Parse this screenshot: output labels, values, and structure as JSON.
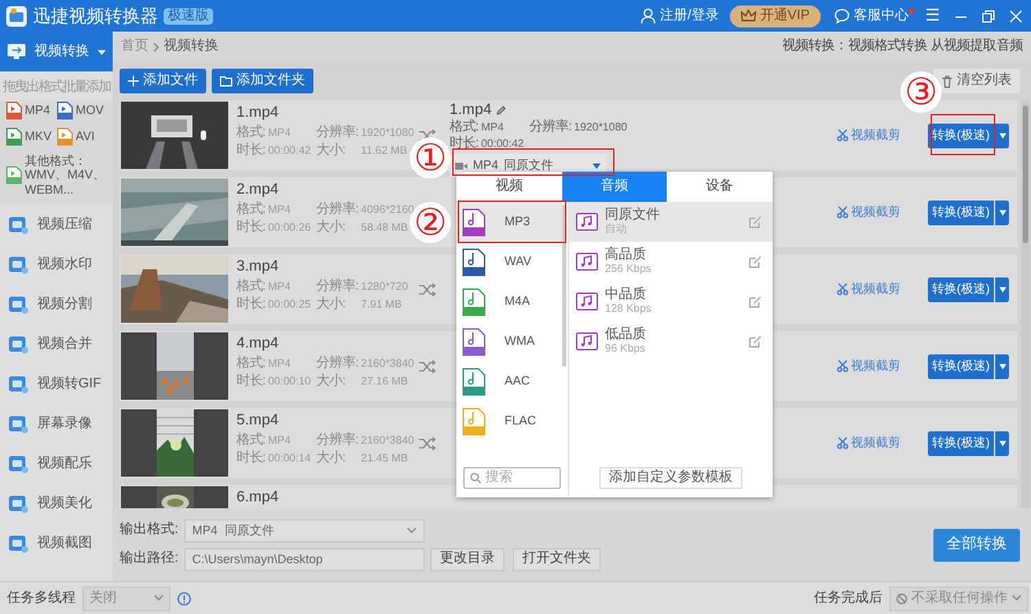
{
  "app": {
    "title": "迅捷视频转换器",
    "edition": "极速版"
  },
  "header": {
    "login": "注册/登录",
    "vip": "开通VIP",
    "support": "客服中心",
    "support_unread": true,
    "menu": "☰"
  },
  "sidebar": {
    "current": {
      "label": "视频转换",
      "expanded": true
    },
    "hint": "拖曳出格式批量添加",
    "formats": [
      {
        "label": "MP4",
        "color": "#e0583a"
      },
      {
        "label": "MOV",
        "color": "#3a6ec0"
      },
      {
        "label": "MKV",
        "color": "#3aa050"
      },
      {
        "label": "AVI",
        "color": "#e8902a"
      },
      {
        "label": "其他格式：WMV、M4V、WEBM...",
        "color": "#5ab86a"
      }
    ],
    "items": [
      {
        "label": "视频压缩"
      },
      {
        "label": "视频水印"
      },
      {
        "label": "视频分割"
      },
      {
        "label": "视频合并"
      },
      {
        "label": "视频转GIF"
      },
      {
        "label": "屏幕录像"
      },
      {
        "label": "视频配乐"
      },
      {
        "label": "视频美化"
      },
      {
        "label": "视频截图"
      }
    ]
  },
  "breadcrumb": {
    "home": "首页",
    "current": "视频转换"
  },
  "description": "视频转换：视频格式转换 从视频提取音频",
  "toolbar": {
    "add_file": "添加文件",
    "add_folder": "添加文件夹",
    "clear": "清空列表"
  },
  "files": [
    {
      "name": "1.mp4",
      "info": [
        {
          "label": "格式:",
          "value": "MP4"
        },
        {
          "label": "分辨率:",
          "value": "1920*1080"
        },
        {
          "label": "时长:",
          "value": "00:00:42"
        },
        {
          "label": "大小:",
          "value": "11.62 MB"
        }
      ],
      "swap_icon": true,
      "output": {
        "name": "1.mp4",
        "info": [
          {
            "label": "格式:",
            "value": "MP4"
          },
          {
            "label": "分辨率:",
            "value": "1920*1080"
          },
          {
            "label": "时长:",
            "value": "00:00:42"
          }
        ],
        "format": "MP4",
        "preset": "同原文件"
      },
      "trim": "视频截剪",
      "convert": "转换(极速)"
    },
    {
      "name": "2.mp4",
      "info": [
        {
          "label": "格式:",
          "value": "MP4"
        },
        {
          "label": "分辨率:",
          "value": "4096*2160"
        },
        {
          "label": "时长:",
          "value": "00:00:26"
        },
        {
          "label": "大小:",
          "value": "58.48 MB"
        }
      ],
      "swap_icon": false,
      "trim": "视频截剪",
      "convert": "转换(极速)"
    },
    {
      "name": "3.mp4",
      "info": [
        {
          "label": "格式:",
          "value": "MP4"
        },
        {
          "label": "分辨率:",
          "value": "1280*720"
        },
        {
          "label": "时长:",
          "value": "00:00:25"
        },
        {
          "label": "大小:",
          "value": "7.91 MB"
        }
      ],
      "swap_icon": true,
      "trim": "视频截剪",
      "convert": "转换(极速)"
    },
    {
      "name": "4.mp4",
      "info": [
        {
          "label": "格式:",
          "value": "MP4"
        },
        {
          "label": "分辨率:",
          "value": "2160*3840"
        },
        {
          "label": "时长:",
          "value": "00:00:10"
        },
        {
          "label": "大小:",
          "value": "27.16 MB"
        }
      ],
      "swap_icon": true,
      "trim": "视频截剪",
      "convert": "转换(极速)"
    },
    {
      "name": "5.mp4",
      "info": [
        {
          "label": "格式:",
          "value": "MP4"
        },
        {
          "label": "分辨率:",
          "value": "2160*3840"
        },
        {
          "label": "时长:",
          "value": "00:00:14"
        },
        {
          "label": "大小:",
          "value": "21.45 MB"
        }
      ],
      "swap_icon": true,
      "trim": "视频截剪",
      "convert": "转换(极速)"
    },
    {
      "name": "6.mp4",
      "swap_icon": false
    }
  ],
  "popup": {
    "tabs": [
      {
        "label": "视频",
        "selected": false
      },
      {
        "label": "音频",
        "selected": true
      },
      {
        "label": "设备",
        "selected": false
      }
    ],
    "formats": [
      {
        "label": "MP3",
        "color": "#a43cc0",
        "selected": true
      },
      {
        "label": "WAV",
        "color": "#2a5aa8",
        "selected": false
      },
      {
        "label": "M4A",
        "color": "#3aaa4a",
        "selected": false
      },
      {
        "label": "WMA",
        "color": "#8a5ad0",
        "selected": false
      },
      {
        "label": "AAC",
        "color": "#2a9a8a",
        "selected": false
      },
      {
        "label": "FLAC",
        "color": "#f0b020",
        "selected": false
      }
    ],
    "search_placeholder": "搜索",
    "presets": [
      {
        "title": "同原文件",
        "detail": "自动",
        "selected": true
      },
      {
        "title": "高品质",
        "detail": "256 Kbps",
        "selected": false
      },
      {
        "title": "中品质",
        "detail": "128 Kbps",
        "selected": false
      },
      {
        "title": "低品质",
        "detail": "96 Kbps",
        "selected": false
      }
    ],
    "add_template": "添加自定义参数模板"
  },
  "annotations": [
    {
      "label": "①"
    },
    {
      "label": "②"
    },
    {
      "label": "③"
    }
  ],
  "output": {
    "format_label": "输出格式:",
    "format": "MP4  同原文件",
    "path_label": "输出路径:",
    "path": "C:\\Users\\mayn\\Desktop",
    "change_dir": "更改目录",
    "open_folder": "打开文件夹",
    "convert_all": "全部转换"
  },
  "status_bar": {
    "threads_label": "任务多线程",
    "threads": "关闭",
    "after_label": "任务完成后",
    "after": "不采取任何操作"
  }
}
